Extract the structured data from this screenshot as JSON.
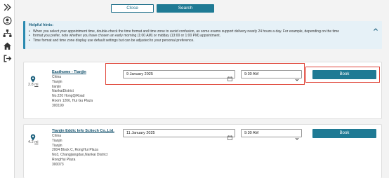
{
  "sidebar": {
    "icons": [
      "chevron-right-double-icon",
      "user-icon",
      "sitemap-icon",
      "home-icon",
      "sign-out-icon"
    ]
  },
  "toolbar": {
    "close_label": "Close",
    "search_label": "Search"
  },
  "hints": {
    "title": "Helpful hints:",
    "items": [
      "When you select your appointment time, double-check the time format and time zone to avoid confusion, as some exams support delivery nearly 24 hours a day. For example, depending on the time",
      "format you prefer, note whether you have chosen an early morning (1:00 AM) or midday (13:00 or 1:00 PM) appointment.",
      "Time format and time zone display use default settings but can be adjusted to your personal preference."
    ]
  },
  "results": [
    {
      "distance": "2.8",
      "unit": "mi",
      "name": "Easthome - Tianjin",
      "lines": [
        "China",
        "Tianjin",
        "tianjin",
        "NankaiDistrict",
        "No.220 HongQiRoad",
        "Room 1206, Hui Gu Plaza",
        "300190"
      ],
      "date": "9 January 2025",
      "time": "9:30 AM",
      "book_label": "Book"
    },
    {
      "distance": "4.2",
      "unit": "mi",
      "name": "Tianjin Eddic Info Scitech Co.,Ltd.",
      "lines": [
        "China",
        "Tianjin",
        "Tianjin",
        "2004 Block C, RongHui Plaza",
        "No3, Changjiangdao,Nankai District",
        "RongHui Plaza",
        "300073"
      ],
      "date": "11 January 2025",
      "time": "9:30 AM",
      "book_label": "Book"
    }
  ],
  "colors": {
    "accent": "#1f7a94",
    "highlight": "#e0463a",
    "hint_bg": "#e6f1f7"
  }
}
